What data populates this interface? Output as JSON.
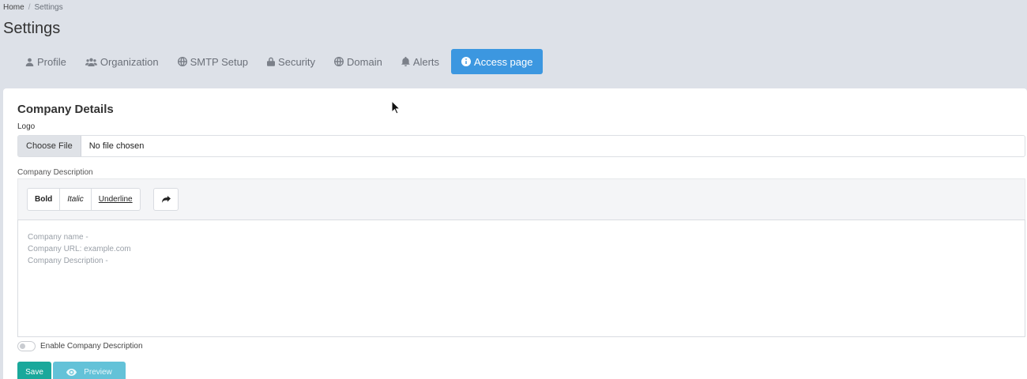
{
  "breadcrumb": {
    "home": "Home",
    "separator": "/",
    "current": "Settings"
  },
  "page": {
    "title": "Settings"
  },
  "tabs": [
    {
      "label": "Profile",
      "icon": "user-icon",
      "active": false
    },
    {
      "label": "Organization",
      "icon": "users-icon",
      "active": false
    },
    {
      "label": "SMTP Setup",
      "icon": "globe-icon",
      "active": false
    },
    {
      "label": "Security",
      "icon": "lock-icon",
      "active": false
    },
    {
      "label": "Domain",
      "icon": "globe-icon",
      "active": false
    },
    {
      "label": "Alerts",
      "icon": "bell-icon",
      "active": false
    },
    {
      "label": "Access page",
      "icon": "info-circle-icon",
      "active": true
    }
  ],
  "company": {
    "section_title": "Company Details",
    "logo_label": "Logo",
    "file_button": "Choose File",
    "file_status": "No file chosen",
    "description_label": "Company Description",
    "toolbar": {
      "bold": "Bold",
      "italic": "Italic",
      "underline": "Underline",
      "redo_icon": "redo-icon"
    },
    "editor_lines": [
      "Company name -",
      "Company URL: example.com",
      "Company Description -"
    ],
    "toggle_label": "Enable Company Description",
    "toggle_on": false
  },
  "actions": {
    "save": "Save",
    "preview": "Preview"
  },
  "colors": {
    "active_tab": "#3c97e0",
    "save": "#1aa89b",
    "preview": "#63c2d8",
    "background": "#dde1e8"
  }
}
